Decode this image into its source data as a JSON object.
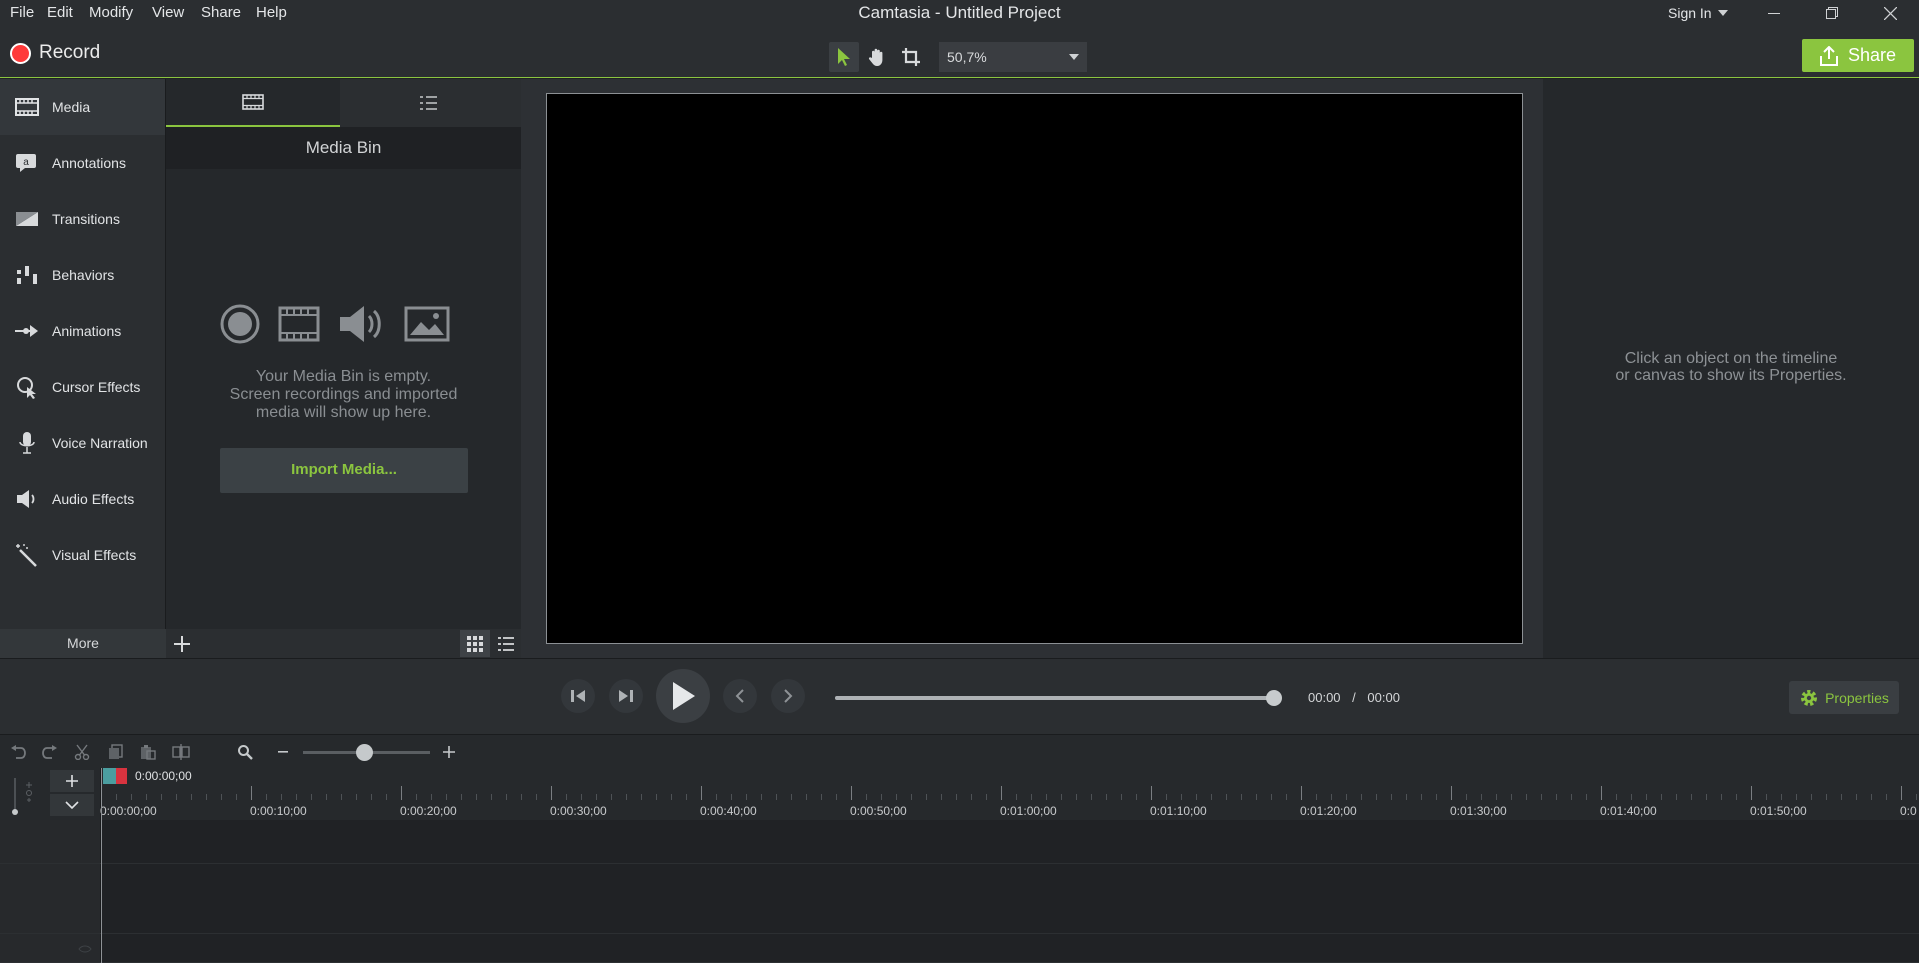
{
  "window": {
    "title": "Camtasia - Untitled Project",
    "menu": [
      "File",
      "Edit",
      "Modify",
      "View",
      "Share",
      "Help"
    ],
    "sign_in": "Sign In"
  },
  "toolbar": {
    "record_label": "Record",
    "zoom_value": "50,7%",
    "share_label": "Share",
    "accent_color": "#8bc53f",
    "record_color": "#ff3a3a"
  },
  "sidebar": {
    "items": [
      {
        "label": "Media",
        "icon": "film-strip-icon"
      },
      {
        "label": "Annotations",
        "icon": "annotation-icon"
      },
      {
        "label": "Transitions",
        "icon": "transition-icon"
      },
      {
        "label": "Behaviors",
        "icon": "behaviors-icon"
      },
      {
        "label": "Animations",
        "icon": "animation-arrow-icon"
      },
      {
        "label": "Cursor Effects",
        "icon": "cursor-effects-icon"
      },
      {
        "label": "Voice Narration",
        "icon": "microphone-icon"
      },
      {
        "label": "Audio Effects",
        "icon": "speaker-icon"
      },
      {
        "label": "Visual Effects",
        "icon": "magic-wand-icon"
      }
    ],
    "more_label": "More"
  },
  "media_bin": {
    "title": "Media Bin",
    "empty_line1": "Your Media Bin is empty.",
    "empty_line2": "Screen recordings and imported",
    "empty_line3": "media will show up here.",
    "import_label": "Import Media..."
  },
  "properties": {
    "hint_line1": "Click an object on the timeline",
    "hint_line2": "or canvas to show its Properties.",
    "button_label": "Properties"
  },
  "playback": {
    "current_time": "00:00",
    "separator": "/",
    "total_time": "00:00",
    "progress": 1.0
  },
  "timeline": {
    "playhead_time": "0:00:00;00",
    "ticks": [
      "0:00:00;00",
      "0:00:10;00",
      "0:00:20;00",
      "0:00:30;00",
      "0:00:40;00",
      "0:00:50;00",
      "0:01:00;00",
      "0:01:10;00",
      "0:01:20;00",
      "0:01:30;00",
      "0:01:40;00",
      "0:01:50;00",
      "0:0"
    ]
  }
}
